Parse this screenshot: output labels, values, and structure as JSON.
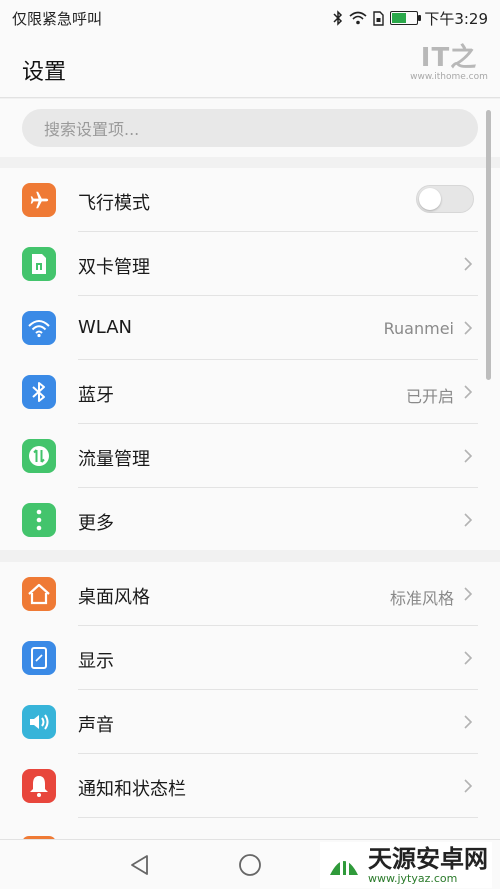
{
  "status": {
    "carrier": "仅限紧急呼叫",
    "time": "下午3:29"
  },
  "header": {
    "title": "设置",
    "watermark_logo": "IT之家",
    "watermark_url": "www.ithome.com"
  },
  "search": {
    "placeholder": "搜索设置项..."
  },
  "group1": [
    {
      "label": "飞行模式",
      "icon": "airplane-icon",
      "color": "#ef7a35",
      "toggle": false
    },
    {
      "label": "双卡管理",
      "icon": "sim-card-icon",
      "color": "#43c46c"
    },
    {
      "label": "WLAN",
      "icon": "wifi-icon",
      "color": "#3a8ae6",
      "value": "Ruanmei"
    },
    {
      "label": "蓝牙",
      "icon": "bluetooth-icon",
      "color": "#3a8ae6",
      "value": "已开启"
    },
    {
      "label": "流量管理",
      "icon": "data-usage-icon",
      "color": "#43c46c"
    },
    {
      "label": "更多",
      "icon": "more-dots-icon",
      "color": "#43c46c"
    }
  ],
  "group2": [
    {
      "label": "桌面风格",
      "icon": "home-icon",
      "color": "#ef7a35",
      "value": "标准风格"
    },
    {
      "label": "显示",
      "icon": "display-icon",
      "color": "#3a8ae6"
    },
    {
      "label": "声音",
      "icon": "speaker-icon",
      "color": "#37b4d9"
    },
    {
      "label": "通知和状态栏",
      "icon": "bell-icon",
      "color": "#e8463c"
    }
  ],
  "nav": {
    "buttons": [
      "back-icon",
      "home-circle-icon",
      "recents-icon"
    ]
  },
  "brand": {
    "name": "天源安卓网",
    "url": "www.jytyaz.com"
  }
}
